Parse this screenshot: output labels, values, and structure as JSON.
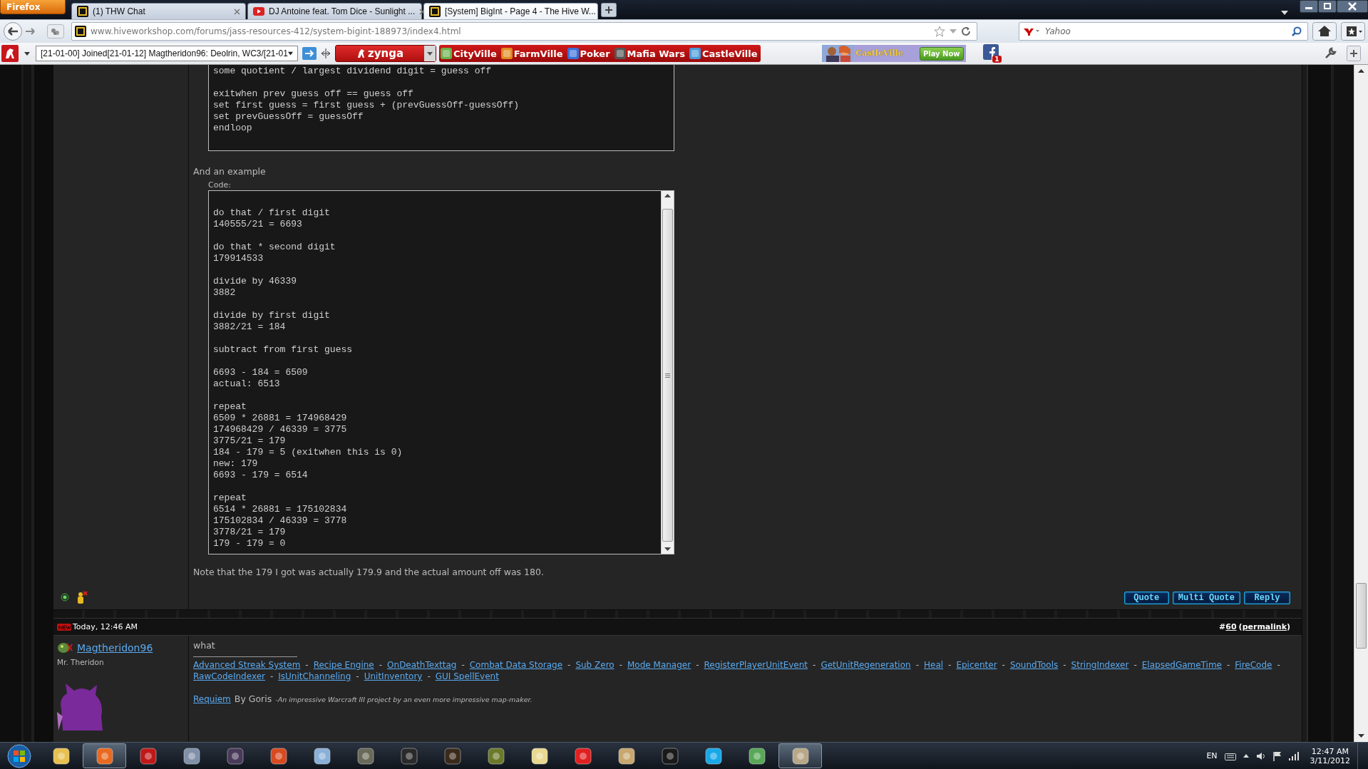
{
  "browser": {
    "menu_button": "Firefox",
    "tabs": [
      {
        "title": "(1) THW Chat",
        "kind": "site",
        "selected": false
      },
      {
        "title": "DJ Antoine feat. Tom Dice - Sunlight ...",
        "kind": "video",
        "selected": false
      },
      {
        "title": "[System] BigInt - Page 4 - The Hive W...",
        "kind": "site",
        "selected": true
      }
    ],
    "address": "www.hiveworkshop.com/forums/jass-resources-412/system-bigint-188973/index4.html",
    "search": {
      "placeholder": "Yahoo"
    }
  },
  "toolbar": {
    "ticker": "[21-01-00] Joined[21-01-12] Magtheridon96: Deolrin, WC3/[21-01",
    "brand": "zynga",
    "games": [
      "CityVille",
      "FarmVille",
      "Poker",
      "Mafia Wars",
      "CastleVille"
    ],
    "banner": {
      "title": "CastleVille",
      "button": "Play Now"
    },
    "notifications": "1"
  },
  "post": {
    "code_top": [
      [
        "some quotient / largest dividend digit = guess off"
      ],
      [
        "exitwhen prev guess off == guess off",
        "set first guess = first guess + (prevGuessOff-guessOff)",
        "set prevGuessOff = guessOff",
        "endloop"
      ]
    ],
    "intro": "And an example",
    "code_label": "Code:",
    "code": [
      [
        "do that / first digit",
        "140555/21 = 6693"
      ],
      [
        "do that * second digit",
        "179914533"
      ],
      [
        "divide by 46339",
        "3882"
      ],
      [
        "divide by first digit",
        "3882/21 = 184"
      ],
      [
        "subtract from first guess"
      ],
      [
        "6693 - 184 = 6509",
        "actual: 6513"
      ],
      [
        "repeat",
        "6509 * 26881 = 174968429",
        "174968429 / 46339 = 3775",
        "3775/21 = 179",
        "184 - 179 = 5 (exitwhen this is 0)",
        "new: 179",
        "6693 - 179 = 6514"
      ],
      [
        "repeat",
        "6514 * 26881 = 175102834",
        "175102834 / 46339 = 3778",
        "3778/21 = 179",
        "179 - 179 = 0"
      ]
    ],
    "note": "Note that the 179 I got was actually 179.9 and the actual amount off was 180.",
    "buttons": [
      "Quote",
      "Multi Quote",
      "Reply"
    ]
  },
  "next_post": {
    "date": "Today, 12:46 AM",
    "number_prefix": "#",
    "number": "60",
    "permalink_open": "(",
    "permalink": "permalink",
    "permalink_close": ")",
    "author": "Magtheridon96",
    "user_title": "Mr. Theridon",
    "message": "what",
    "signature": {
      "links": [
        "Advanced Streak System",
        "Recipe Engine",
        "OnDeathTexttag",
        "Combat Data Storage",
        "Sub Zero",
        "Mode Manager",
        "RegisterPlayerUnitEvent",
        "GetUnitRegeneration",
        "Heal",
        "Epicenter",
        "SoundTools",
        "StringIndexer",
        "ElapsedGameTime",
        "FireCode",
        "RawCodeIndexer",
        "IsUnitChanneling",
        "UnitInventory",
        "GUI SpellEvent"
      ],
      "separator": "-",
      "project": "Requiem",
      "by": "By Goris",
      "tagline": "-An impressive Warcraft III project by an even more impressive map-maker."
    }
  },
  "taskbar": {
    "apps": [
      {
        "selected": false
      },
      {
        "selected": true
      },
      {
        "selected": false
      },
      {
        "selected": false
      },
      {
        "selected": false
      },
      {
        "selected": false
      },
      {
        "selected": false
      },
      {
        "selected": false
      },
      {
        "selected": false
      },
      {
        "selected": false
      },
      {
        "selected": false
      },
      {
        "selected": false
      },
      {
        "selected": false
      },
      {
        "selected": false
      },
      {
        "selected": false
      },
      {
        "selected": false
      },
      {
        "selected": false
      },
      {
        "selected": true
      }
    ],
    "language": "EN",
    "time": "12:47 AM",
    "date": "3/11/2012"
  }
}
